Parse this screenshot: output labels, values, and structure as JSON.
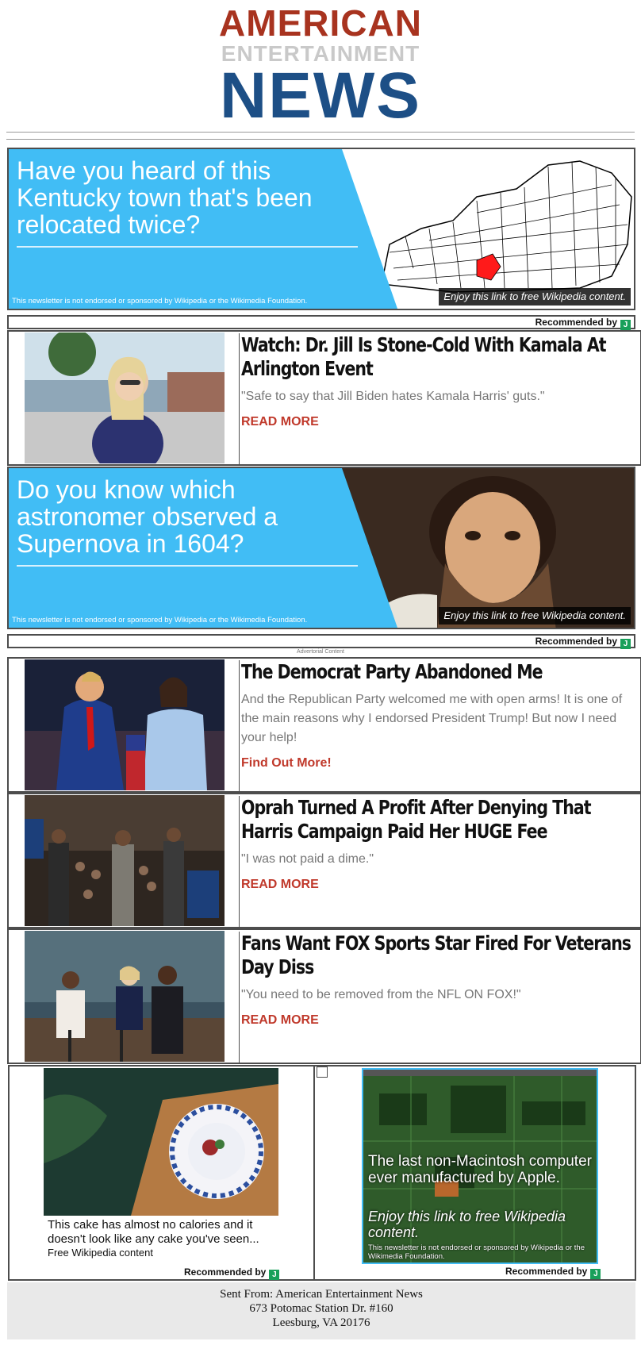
{
  "masthead": {
    "line1": "AMERICAN",
    "line2": "ENTERTAINMENT",
    "line3": "NEWS"
  },
  "ads": [
    {
      "question": "Have you heard of this Kentucky town that's been relocated twice?",
      "disclaimer": "This newsletter is not endorsed or sponsored by Wikipedia or the Wikimedia Foundation.",
      "caption": "Enjoy this link to free Wikipedia content.",
      "recommended": "Recommended by"
    },
    {
      "question": "Do you know which astronomer observed a Supernova in 1604?",
      "disclaimer": "This newsletter is not endorsed or sponsored by Wikipedia or the Wikimedia Foundation.",
      "caption": "Enjoy this link to free Wikipedia content.",
      "recommended": "Recommended by"
    }
  ],
  "advertorial_label": "Advertorial Content",
  "articles": [
    {
      "title": "Watch: Dr. Jill Is Stone-Cold With Kamala At Arlington Event",
      "excerpt": "\"Safe to say that Jill Biden hates Kamala Harris' guts.\"",
      "cta": "READ MORE"
    },
    {
      "title": "The Democrat Party Abandoned Me",
      "excerpt": "And the Republican Party welcomed me with open arms! It is one of the main reasons why I endorsed President Trump! But now I need your help!",
      "cta": "Find Out More!"
    },
    {
      "title": "Oprah Turned A Profit After Denying That Harris Campaign Paid Her HUGE Fee",
      "excerpt": "\"I was not paid a dime.\"",
      "cta": "READ MORE"
    },
    {
      "title": "Fans Want FOX Sports Star Fired For Veterans Day Diss",
      "excerpt": "\"You need to be removed from the NFL ON FOX!\"",
      "cta": "READ MORE"
    }
  ],
  "pair": {
    "left": {
      "text": "This cake has almost no calories and it doesn't look like any cake you've seen...",
      "source": "Free Wikipedia content",
      "recommended": "Recommended by"
    },
    "right": {
      "headline": "The last non-Macintosh computer ever manufactured by Apple.",
      "caption": "Enjoy this link to free Wikipedia content.",
      "disclaimer": "This newsletter is not endorsed or sponsored by Wikipedia or the Wikimedia Foundation.",
      "recommended": "Recommended by"
    },
    "badge_letter": "J"
  },
  "footer": {
    "line1": "Sent From: American Entertainment News",
    "line2": "673 Potomac Station Dr. #160",
    "line3": "Leesburg, VA 20176"
  }
}
